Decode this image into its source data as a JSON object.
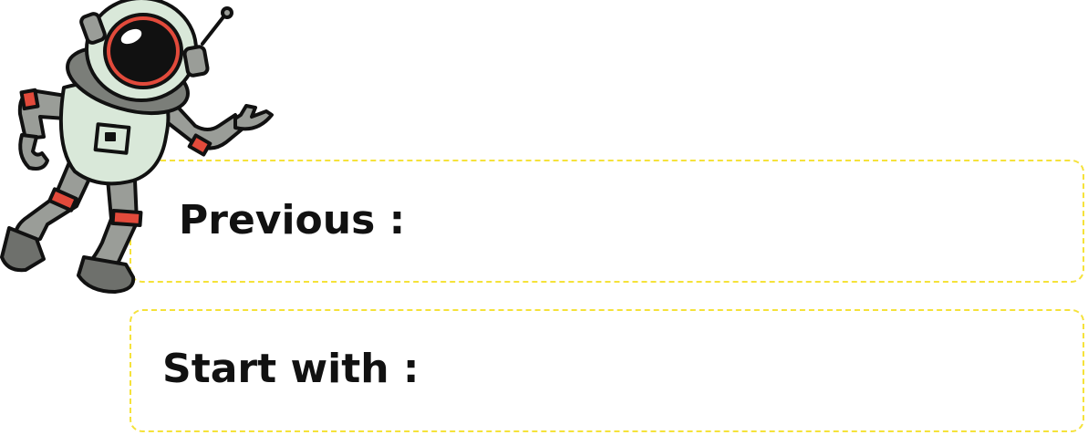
{
  "fields": [
    {
      "label": "Previous :"
    },
    {
      "label": "Start with :"
    }
  ],
  "illustration": {
    "icon": "astronaut-icon",
    "colors": {
      "suit": "#d9e8d9",
      "limbs": "#9a9d98",
      "accent": "#e24a3b",
      "outline": "#111111"
    }
  },
  "colors": {
    "box_border": "#f5e23a",
    "text": "#111111",
    "background": "#ffffff"
  }
}
